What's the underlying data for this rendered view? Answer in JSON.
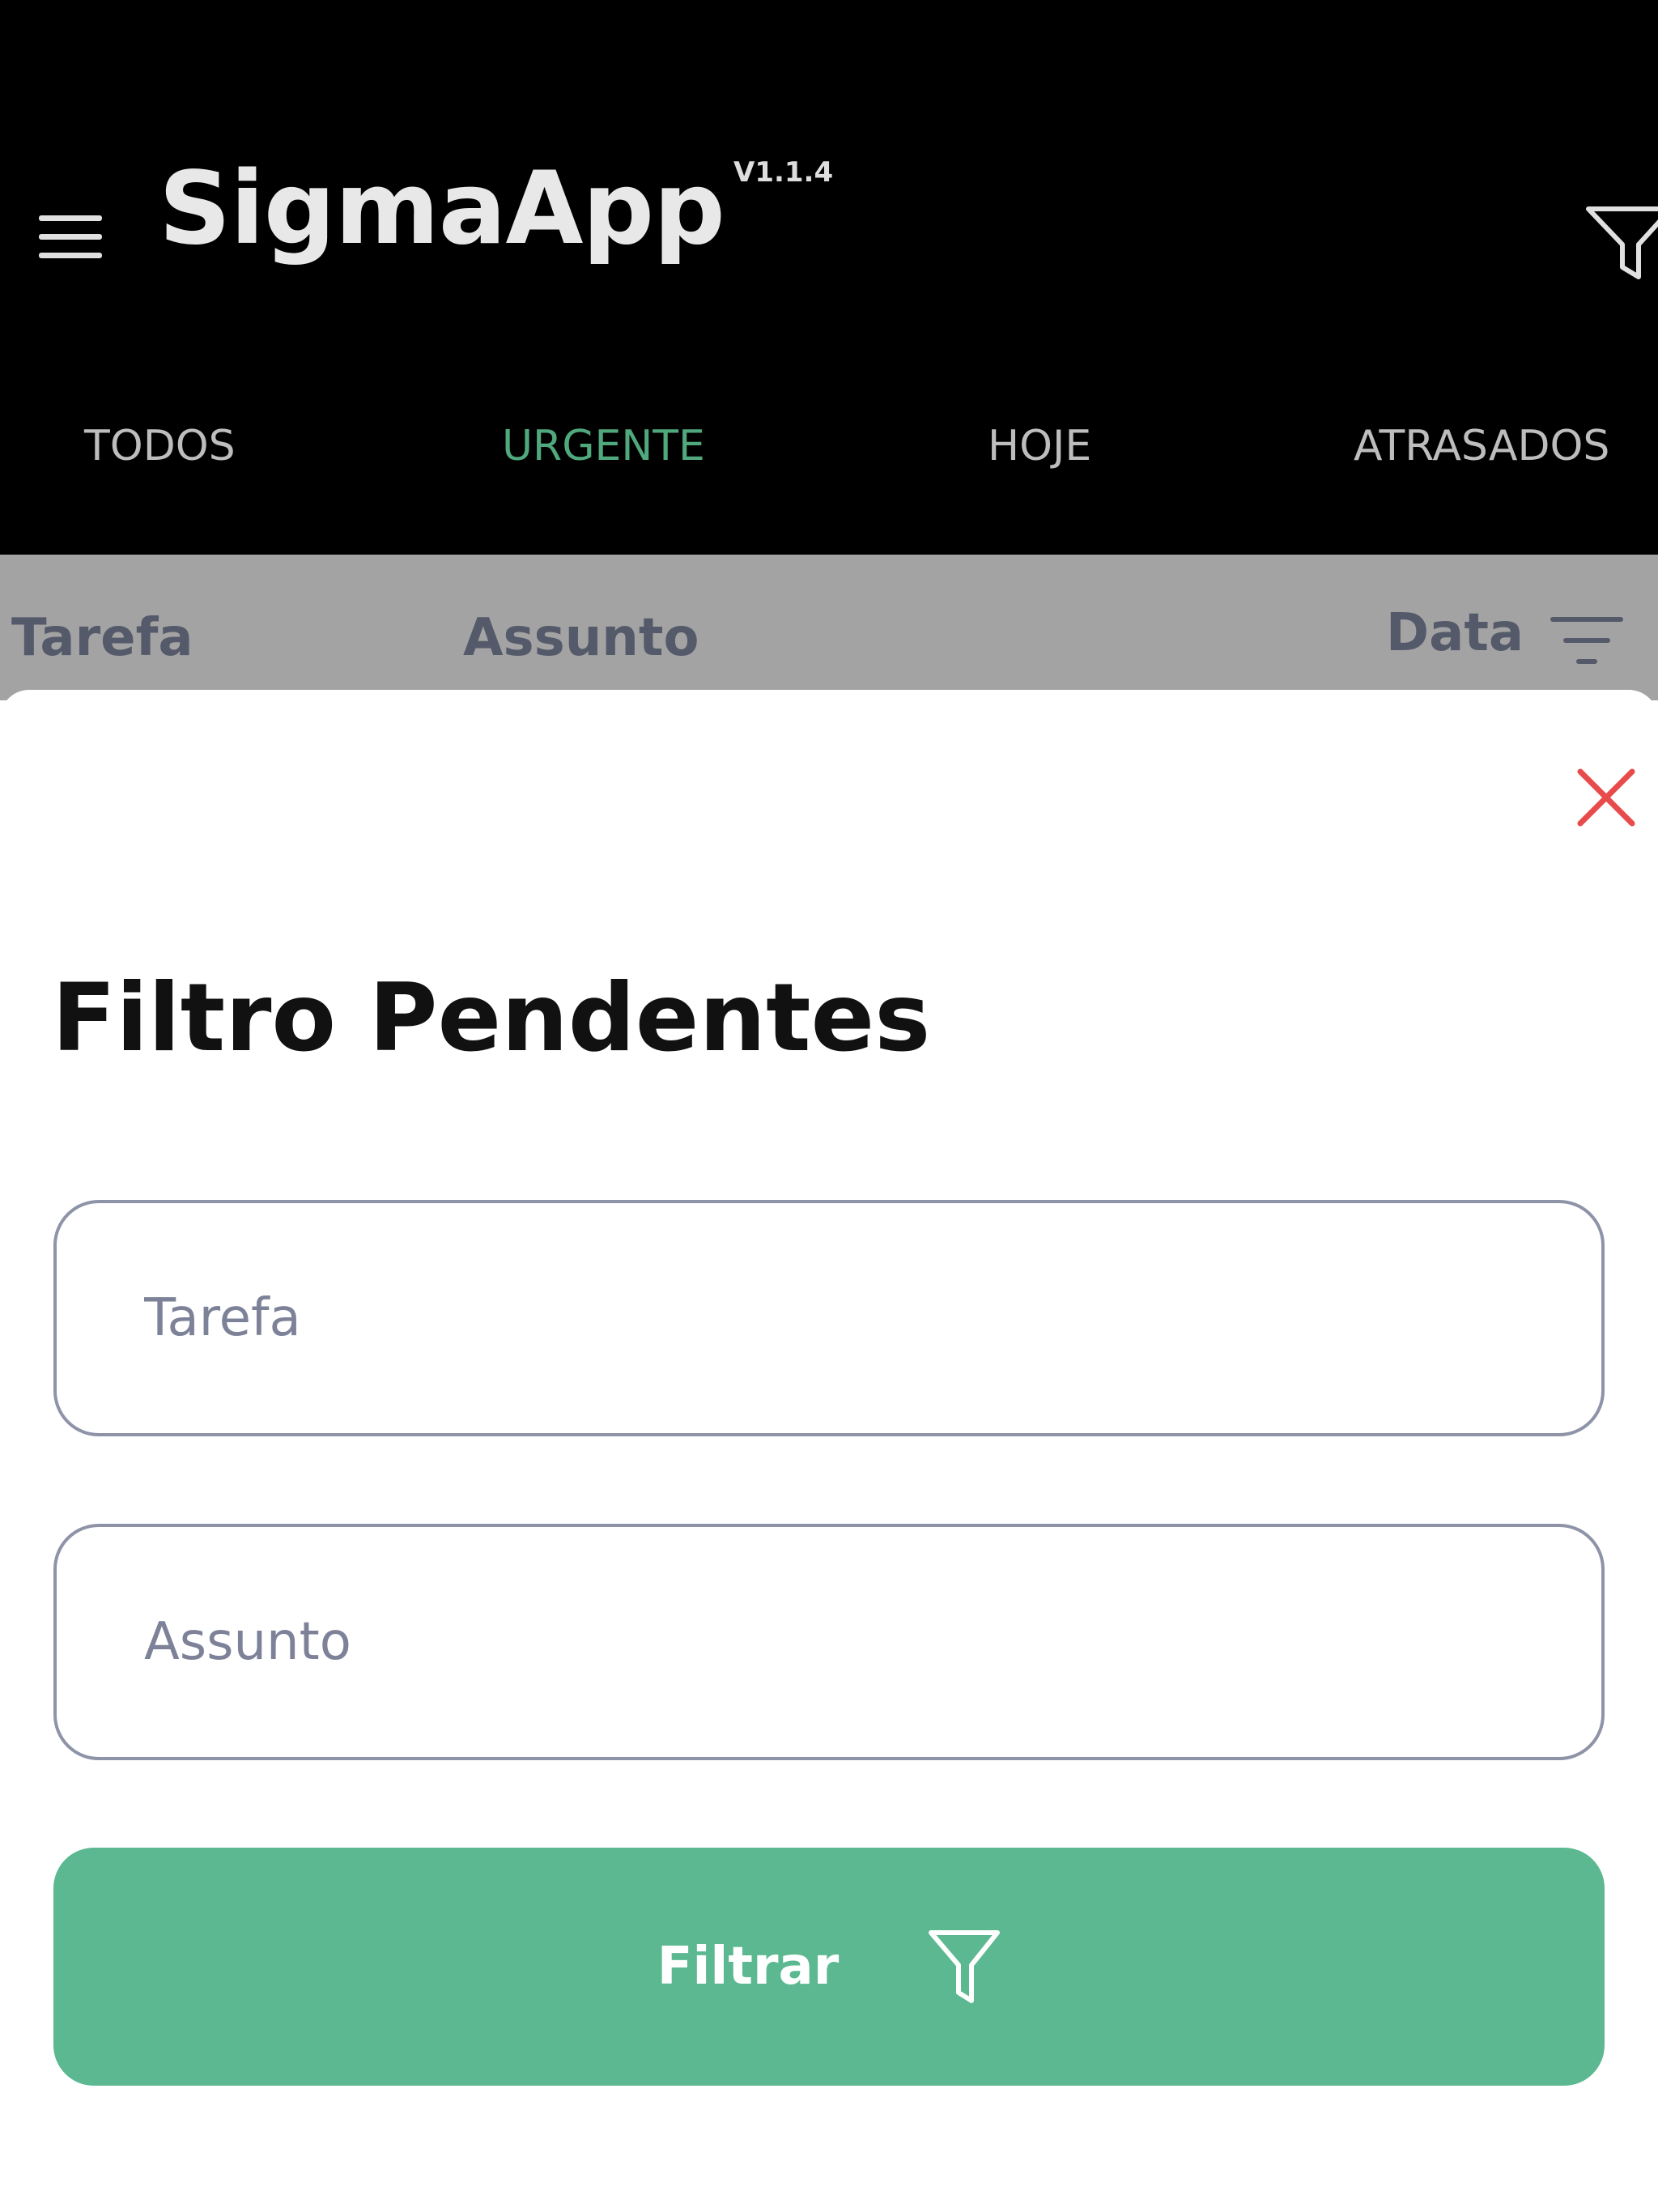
{
  "appbar": {
    "title": "SigmaApp",
    "version": "V1.1.4",
    "menu_icon": "hamburger-menu-icon",
    "filter_icon": "filter-icon"
  },
  "tabs": [
    {
      "label": "TODOS",
      "active": false
    },
    {
      "label": "URGENTE",
      "active": true
    },
    {
      "label": "HOJE",
      "active": false
    },
    {
      "label": "ATRASADOS",
      "active": false
    }
  ],
  "columns": {
    "tarefa": "Tarefa",
    "assunto": "Assunto",
    "data": "Data",
    "sort_icon": "sort-icon"
  },
  "sheet": {
    "title": "Filtro Pendentes",
    "close_icon": "close-icon",
    "fields": {
      "tarefa": {
        "placeholder": "Tarefa",
        "value": ""
      },
      "assunto": {
        "placeholder": "Assunto",
        "value": ""
      }
    },
    "button": {
      "label": "Filtrar",
      "icon": "filter-icon"
    }
  },
  "colors": {
    "accent": "#5bb890",
    "tab_active": "#4fa97d",
    "close": "#e84b4b",
    "header_bg": "#000000",
    "column_bar_bg": "#a3a3a3"
  }
}
